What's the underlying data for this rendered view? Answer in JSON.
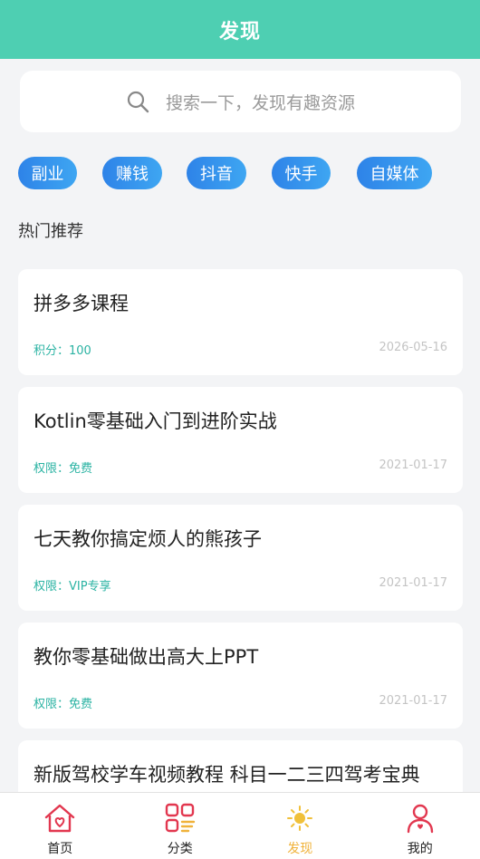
{
  "header": {
    "title": "发现"
  },
  "search": {
    "placeholder": "搜索一下，发现有趣资源",
    "icon": "search-icon"
  },
  "tags": [
    "副业",
    "赚钱",
    "抖音",
    "快手",
    "自媒体"
  ],
  "section": {
    "title": "热门推荐"
  },
  "items": [
    {
      "title": "拼多多课程",
      "meta": "积分：100",
      "date": "2026-05-16"
    },
    {
      "title": "Kotlin零基础入门到进阶实战",
      "meta": "权限：免费",
      "date": "2021-01-17"
    },
    {
      "title": "七天教你搞定烦人的熊孩子",
      "meta": "权限：VIP专享",
      "date": "2021-01-17"
    },
    {
      "title": "教你零基础做出高大上PPT",
      "meta": "权限：免费",
      "date": "2021-01-17"
    },
    {
      "title": "新版驾校学车视频教程 科目一二三四驾考宝典",
      "meta": "",
      "date": ""
    }
  ],
  "nav": [
    {
      "label": "首页",
      "icon": "home-icon",
      "active": false
    },
    {
      "label": "分类",
      "icon": "category-icon",
      "active": false
    },
    {
      "label": "发现",
      "icon": "discover-sun-icon",
      "active": true
    },
    {
      "label": "我的",
      "icon": "profile-icon",
      "active": false
    }
  ],
  "colors": {
    "header": "#4ecfb2",
    "tag": "#2e83e8",
    "meta": "#2bb3a3",
    "active_nav": "#f0b23a",
    "nav_icon": "#e2374f"
  }
}
